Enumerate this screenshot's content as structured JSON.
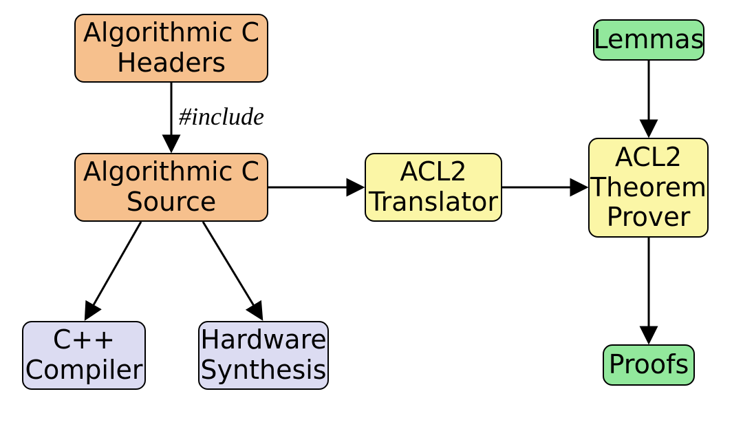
{
  "nodes": {
    "headers": {
      "label": "Algorithmic C\nHeaders",
      "color": "orange"
    },
    "source": {
      "label": "Algorithmic C\nSource",
      "color": "orange"
    },
    "translator": {
      "label": "ACL2\nTranslator",
      "color": "yellow"
    },
    "prover": {
      "label": "ACL2\nTheorem\nProver",
      "color": "yellow"
    },
    "lemmas": {
      "label": "Lemmas",
      "color": "green"
    },
    "proofs": {
      "label": "Proofs",
      "color": "green"
    },
    "cpp": {
      "label": "C++\nCompiler",
      "color": "lav"
    },
    "hw": {
      "label": "Hardware\nSynthesis",
      "color": "lav"
    }
  },
  "edges": [
    {
      "from": "headers",
      "to": "source",
      "label": "#include"
    },
    {
      "from": "source",
      "to": "translator",
      "label": ""
    },
    {
      "from": "translator",
      "to": "prover",
      "label": ""
    },
    {
      "from": "lemmas",
      "to": "prover",
      "label": ""
    },
    {
      "from": "prover",
      "to": "proofs",
      "label": ""
    },
    {
      "from": "source",
      "to": "cpp",
      "label": ""
    },
    {
      "from": "source",
      "to": "hw",
      "label": ""
    }
  ],
  "font_sizes": {
    "node": 38,
    "edge_label": 36
  },
  "edge_labels": {
    "include": "#include"
  }
}
